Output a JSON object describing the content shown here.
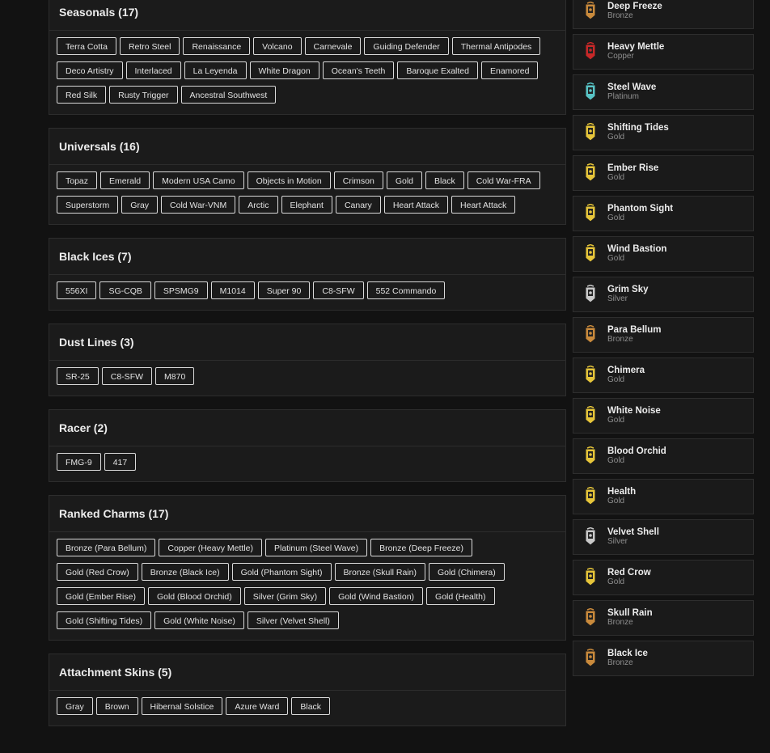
{
  "sections": [
    {
      "title": "Seasonals (17)",
      "items": [
        "Terra Cotta",
        "Retro Steel",
        "Renaissance",
        "Volcano",
        "Carnevale",
        "Guiding Defender",
        "Thermal Antipodes",
        "Deco Artistry",
        "Interlaced",
        "La Leyenda",
        "White Dragon",
        "Ocean's Teeth",
        "Baroque Exalted",
        "Enamored",
        "Red Silk",
        "Rusty Trigger",
        "Ancestral Southwest"
      ]
    },
    {
      "title": "Universals (16)",
      "items": [
        "Topaz",
        "Emerald",
        "Modern USA Camo",
        "Objects in Motion",
        "Crimson",
        "Gold",
        "Black",
        "Cold War-FRA",
        "Superstorm",
        "Gray",
        "Cold War-VNM",
        "Arctic",
        "Elephant",
        "Canary",
        "Heart Attack",
        "Heart Attack"
      ]
    },
    {
      "title": "Black Ices (7)",
      "items": [
        "556XI",
        "SG-CQB",
        "SPSMG9",
        "M1014",
        "Super 90",
        "C8-SFW",
        "552 Commando"
      ]
    },
    {
      "title": "Dust Lines (3)",
      "items": [
        "SR-25",
        "C8-SFW",
        "M870"
      ]
    },
    {
      "title": "Racer (2)",
      "items": [
        "FMG-9",
        "417"
      ]
    },
    {
      "title": "Ranked Charms (17)",
      "items": [
        "Bronze (Para Bellum)",
        "Copper (Heavy Mettle)",
        "Platinum (Steel Wave)",
        "Bronze (Deep Freeze)",
        "Gold (Red Crow)",
        "Bronze (Black Ice)",
        "Gold (Phantom Sight)",
        "Bronze (Skull Rain)",
        "Gold (Chimera)",
        "Gold (Ember Rise)",
        "Gold (Blood Orchid)",
        "Silver (Grim Sky)",
        "Gold (Wind Bastion)",
        "Gold (Health)",
        "Gold (Shifting Tides)",
        "Gold (White Noise)",
        "Silver (Velvet Shell)"
      ]
    },
    {
      "title": "Attachment Skins (5)",
      "items": [
        "Gray",
        "Brown",
        "Hibernal Solstice",
        "Azure Ward",
        "Black"
      ]
    }
  ],
  "tier_colors": {
    "Bronze": "#c98a3c",
    "Copper": "#c82828",
    "Platinum": "#58c4c6",
    "Gold": "#e6c53a",
    "Silver": "#c9c9c9"
  },
  "ranks": [
    {
      "name": "Deep Freeze",
      "tier": "Bronze",
      "icon": "bronze-rank-badge-icon"
    },
    {
      "name": "Heavy Mettle",
      "tier": "Copper",
      "icon": "copper-rank-badge-icon"
    },
    {
      "name": "Steel Wave",
      "tier": "Platinum",
      "icon": "platinum-rank-badge-icon"
    },
    {
      "name": "Shifting Tides",
      "tier": "Gold",
      "icon": "gold-rank-badge-icon"
    },
    {
      "name": "Ember Rise",
      "tier": "Gold",
      "icon": "gold-rank-badge-icon"
    },
    {
      "name": "Phantom Sight",
      "tier": "Gold",
      "icon": "gold-rank-badge-icon"
    },
    {
      "name": "Wind Bastion",
      "tier": "Gold",
      "icon": "gold-rank-badge-icon"
    },
    {
      "name": "Grim Sky",
      "tier": "Silver",
      "icon": "silver-rank-badge-icon"
    },
    {
      "name": "Para Bellum",
      "tier": "Bronze",
      "icon": "bronze-rank-badge-icon"
    },
    {
      "name": "Chimera",
      "tier": "Gold",
      "icon": "gold-rank-badge-icon"
    },
    {
      "name": "White Noise",
      "tier": "Gold",
      "icon": "gold-rank-badge-icon"
    },
    {
      "name": "Blood Orchid",
      "tier": "Gold",
      "icon": "gold-rank-badge-icon"
    },
    {
      "name": "Health",
      "tier": "Gold",
      "icon": "gold-rank-badge-icon"
    },
    {
      "name": "Velvet Shell",
      "tier": "Silver",
      "icon": "silver-rank-badge-icon"
    },
    {
      "name": "Red Crow",
      "tier": "Gold",
      "icon": "gold-rank-badge-icon"
    },
    {
      "name": "Skull Rain",
      "tier": "Bronze",
      "icon": "bronze-rank-badge-icon"
    },
    {
      "name": "Black Ice",
      "tier": "Bronze",
      "icon": "bronze-rank-badge-icon"
    }
  ]
}
